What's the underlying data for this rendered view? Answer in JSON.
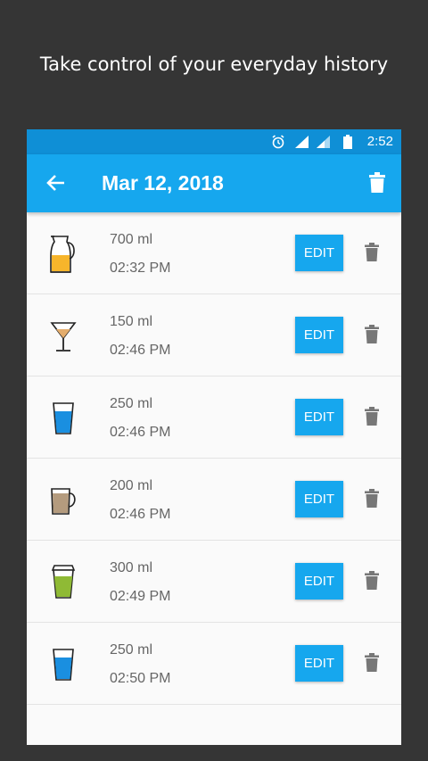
{
  "promo": {
    "text": "Take control of your everyday history"
  },
  "status_bar": {
    "time": "2:52",
    "icons": [
      "alarm-icon",
      "signal-icon",
      "signal-icon",
      "battery-icon"
    ]
  },
  "app_bar": {
    "title": "Mar 12, 2018",
    "back_icon": "arrow-left-icon",
    "action_icon": "trash-icon"
  },
  "colors": {
    "accent": "#16a7ee",
    "status": "#0f8fd6",
    "background": "#353535"
  },
  "entries": [
    {
      "drink_icon": "jug-icon",
      "amount": "700 ml",
      "time": "02:32 PM",
      "edit_label": "EDIT"
    },
    {
      "drink_icon": "cocktail-glass-icon",
      "amount": "150 ml",
      "time": "02:46 PM",
      "edit_label": "EDIT"
    },
    {
      "drink_icon": "water-glass-icon",
      "amount": "250 ml",
      "time": "02:46 PM",
      "edit_label": "EDIT"
    },
    {
      "drink_icon": "coffee-mug-icon",
      "amount": "200 ml",
      "time": "02:46 PM",
      "edit_label": "EDIT"
    },
    {
      "drink_icon": "takeaway-cup-icon",
      "amount": "300 ml",
      "time": "02:49 PM",
      "edit_label": "EDIT"
    },
    {
      "drink_icon": "water-glass-icon",
      "amount": "250 ml",
      "time": "02:50 PM",
      "edit_label": "EDIT"
    }
  ]
}
